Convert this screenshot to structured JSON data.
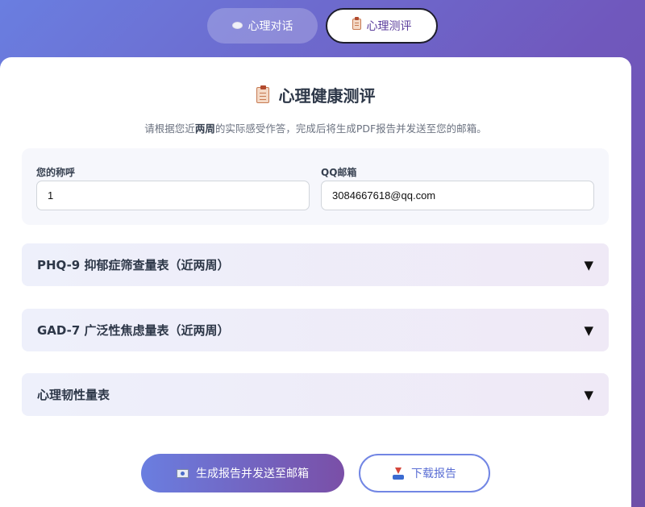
{
  "tabs": {
    "chat": {
      "label": "心理对话",
      "icon": "speech-bubble-icon"
    },
    "assessment": {
      "label": "心理测评",
      "icon": "clipboard-icon"
    }
  },
  "page": {
    "title": "心理健康测评",
    "title_icon": "clipboard-icon",
    "subtitle_prefix": "请根据您近",
    "subtitle_bold": "两周",
    "subtitle_suffix": "的实际感受作答，完成后将生成PDF报告并发送至您的邮箱。"
  },
  "form": {
    "name_label": "您的称呼",
    "name_value": "1",
    "email_label": "QQ邮箱",
    "email_value": "3084667618@qq.com"
  },
  "scales": [
    {
      "title": "PHQ-9 抑郁症筛查量表（近两周）",
      "arrow": "▼"
    },
    {
      "title": "GAD-7 广泛性焦虑量表（近两周）",
      "arrow": "▼"
    },
    {
      "title": "心理韧性量表",
      "arrow": "▼"
    }
  ],
  "actions": {
    "generate_label": "生成报告并发送至邮箱",
    "generate_icon": "email-icon",
    "download_label": "下载报告",
    "download_icon": "download-icon"
  },
  "colors": {
    "accent": "#6a7ee0",
    "accent_purple": "#7a4fa7",
    "active_tab_text": "#5b3e9c"
  }
}
